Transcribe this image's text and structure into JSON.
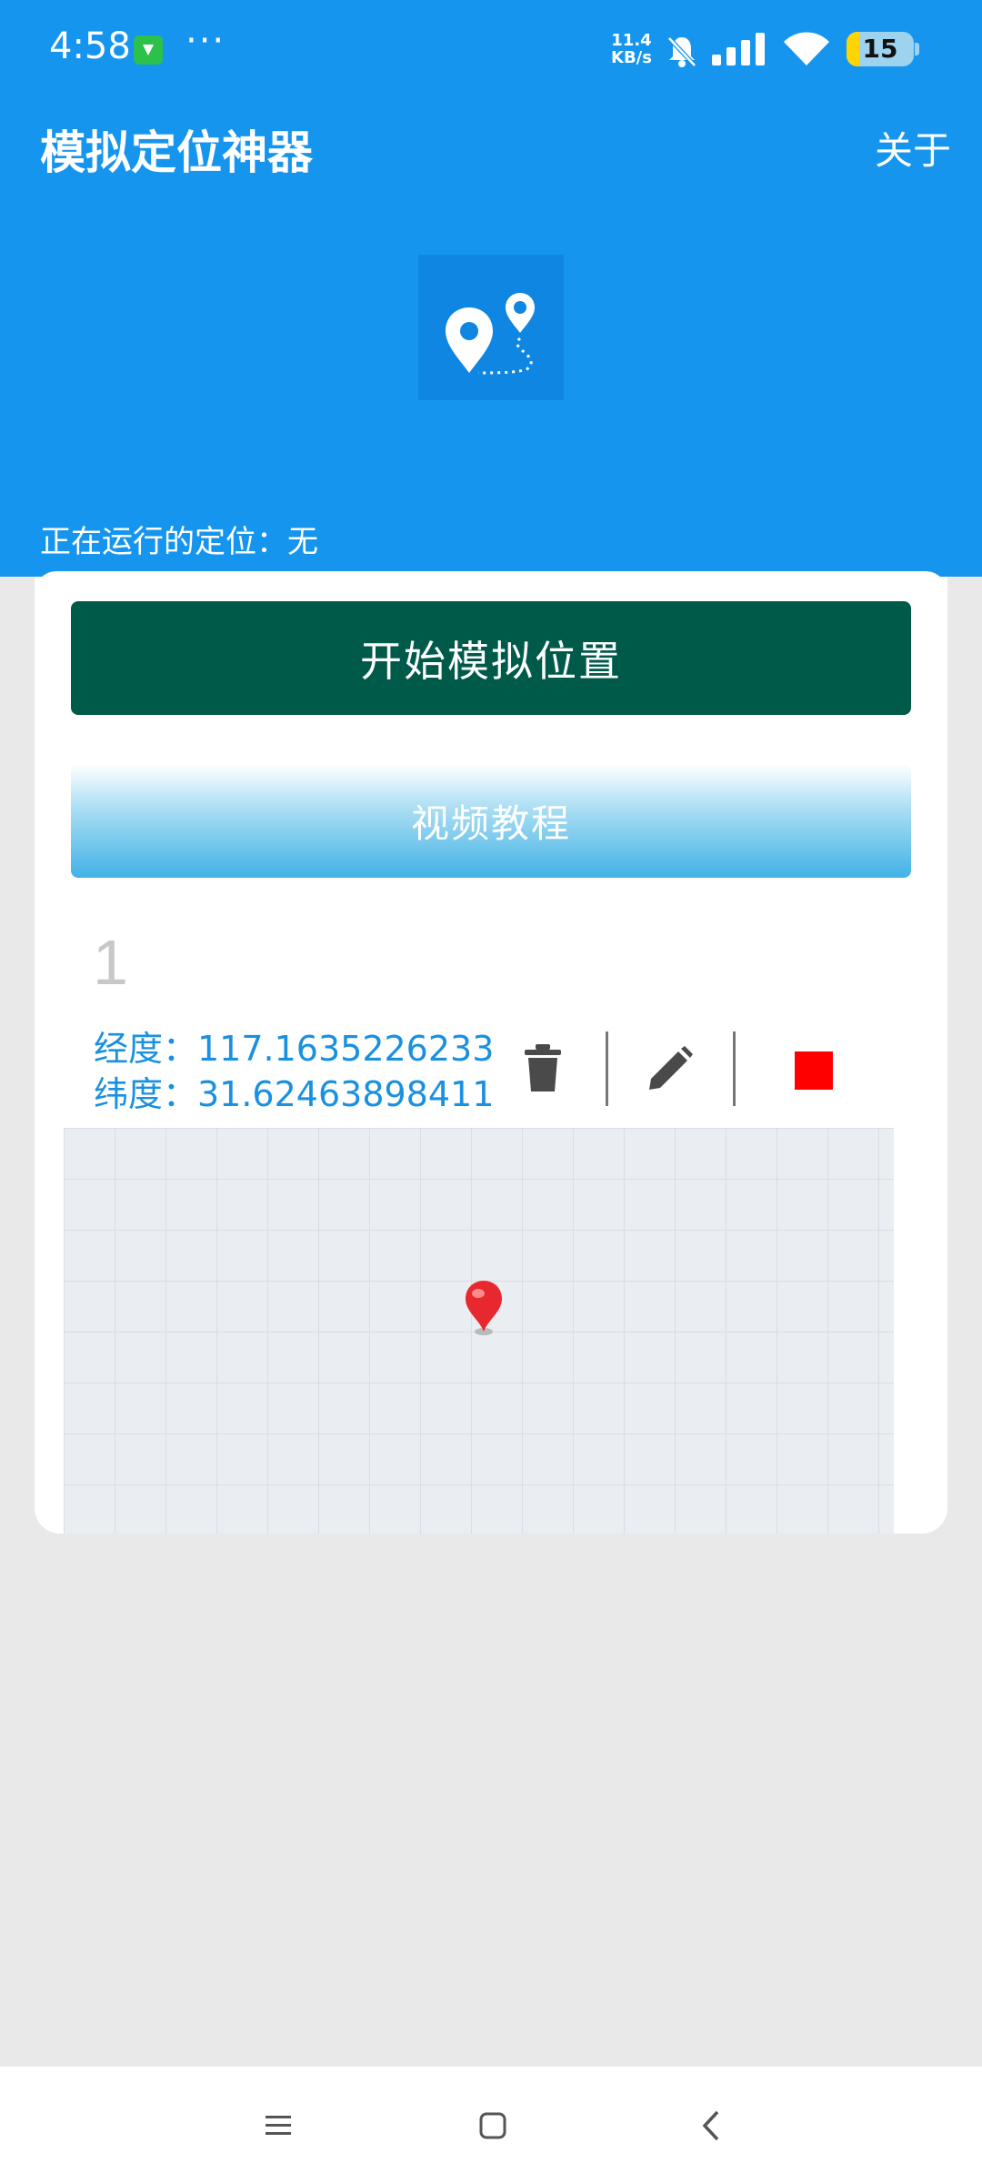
{
  "status_bar": {
    "time": "4:58",
    "more": "···",
    "net_speed_value": "11.4",
    "net_speed_unit": "KB/s",
    "battery_level": "15"
  },
  "header": {
    "title": "模拟定位神器",
    "about_label": "关于",
    "running_status": "正在运行的定位：无"
  },
  "actions": {
    "start_label": "开始模拟位置",
    "tutorial_label": "视频教程"
  },
  "location_item": {
    "index": "1",
    "longitude": "经度：117.1635226233",
    "latitude": "纬度：31.62463898411"
  },
  "colors": {
    "header_bg": "#1695ee",
    "start_button": "#005a4a",
    "coords_text": "#1a90e0",
    "stop": "#ff0000"
  },
  "icons": [
    "store-badge-icon",
    "bell-muted-icon",
    "signal-icon",
    "wifi-icon",
    "battery-icon",
    "location-route-logo-icon",
    "trash-icon",
    "pencil-icon",
    "stop-icon",
    "map-pin-icon",
    "menu-icon",
    "home-icon",
    "back-icon"
  ]
}
